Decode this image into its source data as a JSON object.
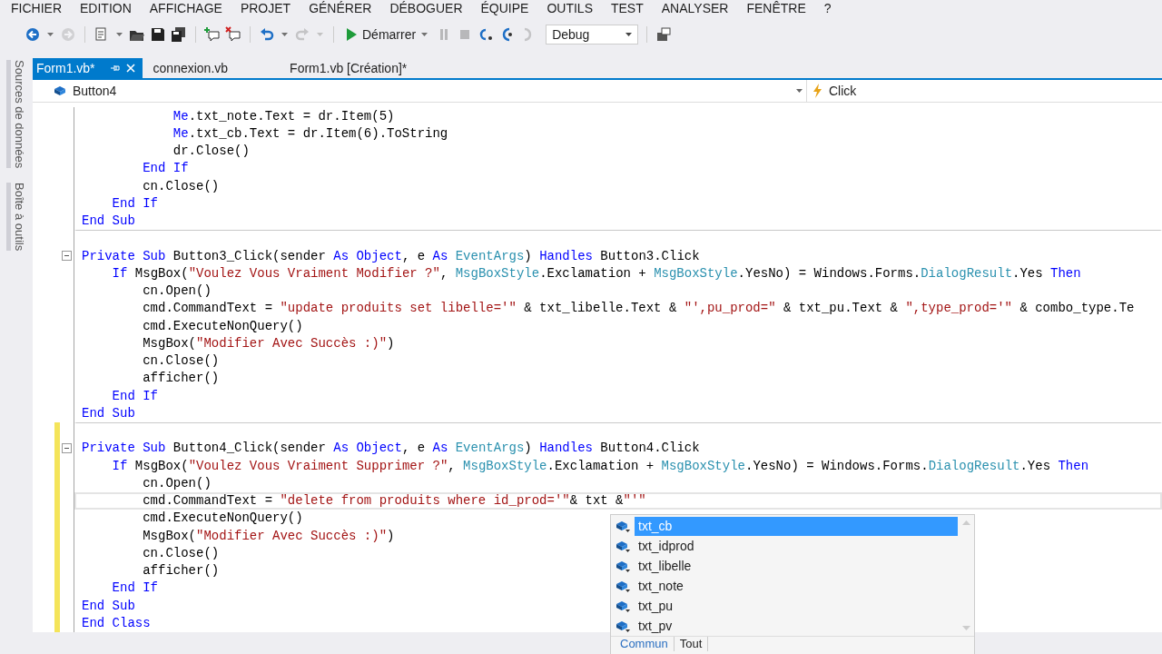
{
  "menu": [
    "FICHIER",
    "EDITION",
    "AFFICHAGE",
    "PROJET",
    "GÉNÉRER",
    "DÉBOGUER",
    "ÉQUIPE",
    "OUTILS",
    "TEST",
    "ANALYSER",
    "FENÊTRE",
    "?"
  ],
  "toolbar": [
    {
      "kind": "back",
      "disabled": false
    },
    {
      "kind": "caret",
      "disabled": false
    },
    {
      "kind": "forward",
      "disabled": true
    },
    {
      "kind": "sep"
    },
    {
      "kind": "new",
      "disabled": false
    },
    {
      "kind": "caret",
      "disabled": false
    },
    {
      "kind": "open",
      "disabled": false
    },
    {
      "kind": "save",
      "disabled": false
    },
    {
      "kind": "saveall",
      "disabled": false
    },
    {
      "kind": "sep"
    },
    {
      "kind": "comment",
      "disabled": false
    },
    {
      "kind": "uncomment",
      "disabled": false
    },
    {
      "kind": "sep"
    },
    {
      "kind": "undo",
      "disabled": false
    },
    {
      "kind": "caret",
      "disabled": false
    },
    {
      "kind": "redo",
      "disabled": true
    },
    {
      "kind": "caret",
      "disabled": true
    },
    {
      "kind": "sep"
    },
    {
      "kind": "start",
      "label": "Démarrer"
    },
    {
      "kind": "pause",
      "disabled": true
    },
    {
      "kind": "stop",
      "disabled": true
    },
    {
      "kind": "stepover",
      "disabled": false
    },
    {
      "kind": "stepinto",
      "disabled": false
    },
    {
      "kind": "stepout",
      "disabled": true
    },
    {
      "kind": "combo",
      "label": "Debug"
    },
    {
      "kind": "sep"
    },
    {
      "kind": "tool",
      "disabled": false
    }
  ],
  "tabs": [
    {
      "label": "Form1.vb*",
      "selected": true
    },
    {
      "label": "connexion.vb",
      "selected": false
    },
    {
      "label": "Form1.vb [Création]*",
      "selected": false
    }
  ],
  "nav": {
    "object": "Button4",
    "member": "Click"
  },
  "side_panels": [
    "Sources de données",
    "Boîte à outils"
  ],
  "code": [
    {
      "kind": "code",
      "changed": false,
      "current": false,
      "collapsible": false,
      "tokens": [
        {
          "kind": "kw",
          "t": "            Me"
        },
        {
          "kind": "plain",
          "t": ".txt_note.Text = dr.Item(5)"
        }
      ]
    },
    {
      "kind": "code",
      "changed": false,
      "current": false,
      "collapsible": false,
      "tokens": [
        {
          "kind": "kw",
          "t": "            Me"
        },
        {
          "kind": "plain",
          "t": ".txt_cb.Text = dr.Item(6).ToString"
        }
      ]
    },
    {
      "kind": "code",
      "changed": false,
      "current": false,
      "collapsible": false,
      "tokens": [
        {
          "kind": "plain",
          "t": "            dr.Close()"
        }
      ]
    },
    {
      "kind": "code",
      "changed": false,
      "current": false,
      "collapsible": false,
      "tokens": [
        {
          "kind": "kw",
          "t": "        End If"
        }
      ]
    },
    {
      "kind": "code",
      "changed": false,
      "current": false,
      "collapsible": false,
      "tokens": [
        {
          "kind": "plain",
          "t": "        cn.Close()"
        }
      ]
    },
    {
      "kind": "code",
      "changed": false,
      "current": false,
      "collapsible": false,
      "tokens": [
        {
          "kind": "kw",
          "t": "    End If"
        }
      ]
    },
    {
      "kind": "code",
      "changed": false,
      "current": false,
      "collapsible": false,
      "tokens": [
        {
          "kind": "kw",
          "t": "End Sub"
        }
      ]
    },
    {
      "kind": "separator",
      "changed": false,
      "current": false,
      "collapsible": false
    },
    {
      "kind": "code",
      "changed": false,
      "current": false,
      "collapsible": true,
      "tokens": [
        {
          "kind": "kw",
          "t": "Private Sub"
        },
        {
          "kind": "plain",
          "t": " Button3_Click(sender "
        },
        {
          "kind": "kw",
          "t": "As Object"
        },
        {
          "kind": "plain",
          "t": ", e "
        },
        {
          "kind": "kw",
          "t": "As "
        },
        {
          "kind": "type",
          "t": "EventArgs"
        },
        {
          "kind": "plain",
          "t": ") "
        },
        {
          "kind": "kw",
          "t": "Handles"
        },
        {
          "kind": "plain",
          "t": " Button3.Click"
        }
      ]
    },
    {
      "kind": "code",
      "changed": false,
      "current": false,
      "collapsible": false,
      "tokens": [
        {
          "kind": "kw",
          "t": "    If"
        },
        {
          "kind": "plain",
          "t": " MsgBox("
        },
        {
          "kind": "str",
          "t": "\"Voulez Vous Vraiment Modifier ?\""
        },
        {
          "kind": "plain",
          "t": ", "
        },
        {
          "kind": "type",
          "t": "MsgBoxStyle"
        },
        {
          "kind": "plain",
          "t": ".Exclamation + "
        },
        {
          "kind": "type",
          "t": "MsgBoxStyle"
        },
        {
          "kind": "plain",
          "t": ".YesNo) = Windows.Forms."
        },
        {
          "kind": "type",
          "t": "DialogResult"
        },
        {
          "kind": "plain",
          "t": ".Yes "
        },
        {
          "kind": "kw",
          "t": "Then"
        }
      ]
    },
    {
      "kind": "code",
      "changed": false,
      "current": false,
      "collapsible": false,
      "tokens": [
        {
          "kind": "plain",
          "t": "        cn.Open()"
        }
      ]
    },
    {
      "kind": "code",
      "changed": false,
      "current": false,
      "collapsible": false,
      "tokens": [
        {
          "kind": "plain",
          "t": "        cmd.CommandText = "
        },
        {
          "kind": "str",
          "t": "\"update produits set libelle='\""
        },
        {
          "kind": "plain",
          "t": " & txt_libelle.Text & "
        },
        {
          "kind": "str",
          "t": "\"',pu_prod=\""
        },
        {
          "kind": "plain",
          "t": " & txt_pu.Text & "
        },
        {
          "kind": "str",
          "t": "\",type_prod='\""
        },
        {
          "kind": "plain",
          "t": " & combo_type.Te"
        }
      ]
    },
    {
      "kind": "code",
      "changed": false,
      "current": false,
      "collapsible": false,
      "tokens": [
        {
          "kind": "plain",
          "t": "        cmd.ExecuteNonQuery()"
        }
      ]
    },
    {
      "kind": "code",
      "changed": false,
      "current": false,
      "collapsible": false,
      "tokens": [
        {
          "kind": "plain",
          "t": "        MsgBox("
        },
        {
          "kind": "str",
          "t": "\"Modifier Avec Succès :)\""
        },
        {
          "kind": "plain",
          "t": ")"
        }
      ]
    },
    {
      "kind": "code",
      "changed": false,
      "current": false,
      "collapsible": false,
      "tokens": [
        {
          "kind": "plain",
          "t": "        cn.Close()"
        }
      ]
    },
    {
      "kind": "code",
      "changed": false,
      "current": false,
      "collapsible": false,
      "tokens": [
        {
          "kind": "plain",
          "t": "        afficher()"
        }
      ]
    },
    {
      "kind": "code",
      "changed": false,
      "current": false,
      "collapsible": false,
      "tokens": [
        {
          "kind": "kw",
          "t": "    End If"
        }
      ]
    },
    {
      "kind": "code",
      "changed": false,
      "current": false,
      "collapsible": false,
      "tokens": [
        {
          "kind": "kw",
          "t": "End Sub"
        }
      ]
    },
    {
      "kind": "separator",
      "changed": true,
      "current": false,
      "collapsible": false
    },
    {
      "kind": "code",
      "changed": true,
      "current": false,
      "collapsible": true,
      "tokens": [
        {
          "kind": "kw",
          "t": "Private Sub"
        },
        {
          "kind": "plain",
          "t": " Button4_Click(sender "
        },
        {
          "kind": "kw",
          "t": "As Object"
        },
        {
          "kind": "plain",
          "t": ", e "
        },
        {
          "kind": "kw",
          "t": "As "
        },
        {
          "kind": "type",
          "t": "EventArgs"
        },
        {
          "kind": "plain",
          "t": ") "
        },
        {
          "kind": "kw",
          "t": "Handles"
        },
        {
          "kind": "plain",
          "t": " Button4.Click"
        }
      ]
    },
    {
      "kind": "code",
      "changed": true,
      "current": false,
      "collapsible": false,
      "tokens": [
        {
          "kind": "kw",
          "t": "    If"
        },
        {
          "kind": "plain",
          "t": " MsgBox("
        },
        {
          "kind": "str",
          "t": "\"Voulez Vous Vraiment Supprimer ?\""
        },
        {
          "kind": "plain",
          "t": ", "
        },
        {
          "kind": "type",
          "t": "MsgBoxStyle"
        },
        {
          "kind": "plain",
          "t": ".Exclamation + "
        },
        {
          "kind": "type",
          "t": "MsgBoxStyle"
        },
        {
          "kind": "plain",
          "t": ".YesNo) = Windows.Forms."
        },
        {
          "kind": "type",
          "t": "DialogResult"
        },
        {
          "kind": "plain",
          "t": ".Yes "
        },
        {
          "kind": "kw",
          "t": "Then"
        }
      ]
    },
    {
      "kind": "code",
      "changed": true,
      "current": false,
      "collapsible": false,
      "tokens": [
        {
          "kind": "plain",
          "t": "        cn.Open()"
        }
      ]
    },
    {
      "kind": "code",
      "changed": true,
      "current": true,
      "collapsible": false,
      "tokens": [
        {
          "kind": "plain",
          "t": "        cmd.CommandText = "
        },
        {
          "kind": "str",
          "t": "\"delete from produits where id_prod='\""
        },
        {
          "kind": "plain",
          "t": "& txt &"
        },
        {
          "kind": "str",
          "t": "\"'\""
        }
      ]
    },
    {
      "kind": "code",
      "changed": true,
      "current": false,
      "collapsible": false,
      "tokens": [
        {
          "kind": "plain",
          "t": "        cmd.ExecuteNonQuery()"
        }
      ]
    },
    {
      "kind": "code",
      "changed": true,
      "current": false,
      "collapsible": false,
      "tokens": [
        {
          "kind": "plain",
          "t": "        MsgBox("
        },
        {
          "kind": "str",
          "t": "\"Modifier Avec Succès :)\""
        },
        {
          "kind": "plain",
          "t": ")"
        }
      ]
    },
    {
      "kind": "code",
      "changed": true,
      "current": false,
      "collapsible": false,
      "tokens": [
        {
          "kind": "plain",
          "t": "        cn.Close()"
        }
      ]
    },
    {
      "kind": "code",
      "changed": true,
      "current": false,
      "collapsible": false,
      "tokens": [
        {
          "kind": "plain",
          "t": "        afficher()"
        }
      ]
    },
    {
      "kind": "code",
      "changed": true,
      "current": false,
      "collapsible": false,
      "tokens": [
        {
          "kind": "kw",
          "t": "    End If"
        }
      ]
    },
    {
      "kind": "code",
      "changed": true,
      "current": false,
      "collapsible": false,
      "tokens": [
        {
          "kind": "kw",
          "t": "End Sub"
        }
      ]
    },
    {
      "kind": "code",
      "changed": true,
      "current": false,
      "collapsible": false,
      "tokens": [
        {
          "kind": "kw",
          "t": "End Class"
        }
      ]
    }
  ],
  "completion": {
    "items": [
      {
        "label": "txt_cb",
        "selected": true
      },
      {
        "label": "txt_idprod",
        "selected": false
      },
      {
        "label": "txt_libelle",
        "selected": false
      },
      {
        "label": "txt_note",
        "selected": false
      },
      {
        "label": "txt_pu",
        "selected": false
      },
      {
        "label": "txt_pv",
        "selected": false
      }
    ],
    "filters": [
      {
        "label": "Commun",
        "selected": true
      },
      {
        "label": "Tout",
        "selected": false
      }
    ]
  }
}
